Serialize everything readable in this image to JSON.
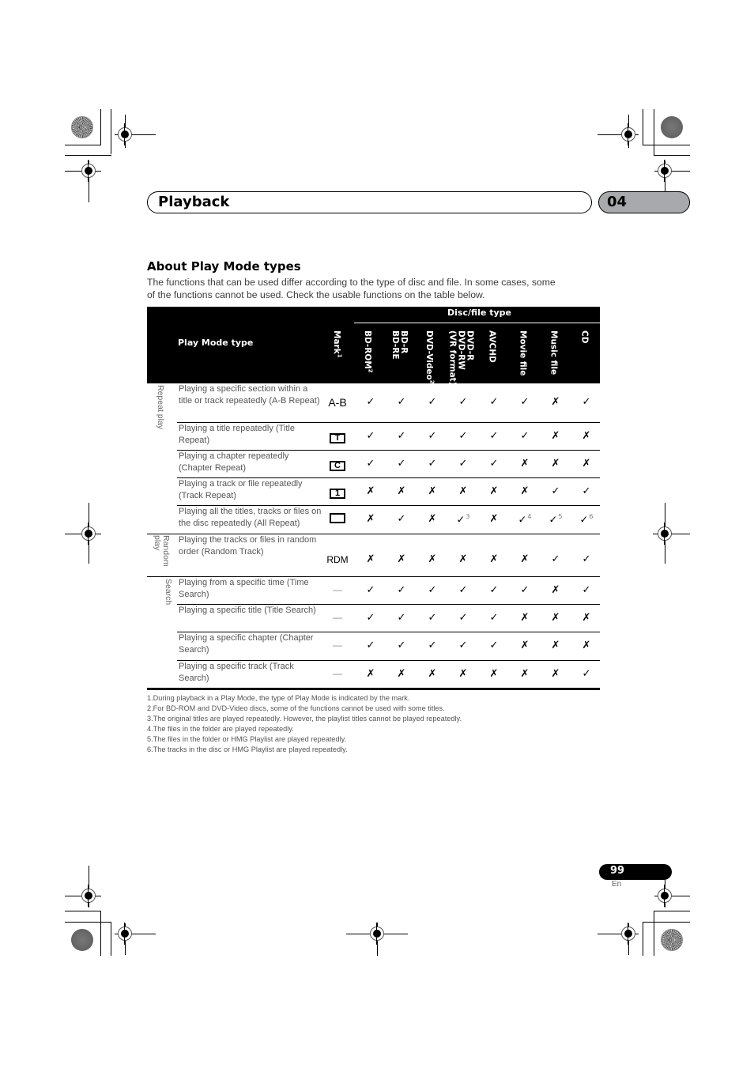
{
  "header": {
    "section_title": "Playback",
    "chapter_number": "04"
  },
  "section": {
    "heading": "About Play Mode types",
    "intro_line1": "The functions that can be used differ according to the type of disc and file. In some cases, some",
    "intro_line2": "of the functions cannot be used. Check the usable functions on the table below."
  },
  "table": {
    "disc_file_type_label": "Disc/file type",
    "play_mode_type_label": "Play Mode type",
    "mark_label": "Mark",
    "mark_note": "1",
    "columns": [
      {
        "label": "BD-ROM",
        "note": "2"
      },
      {
        "label": "BD-R\nBD-RE",
        "note": ""
      },
      {
        "label": "DVD-Video",
        "note": "2"
      },
      {
        "label": "DVD-R\nDVD-RW\n(VR format)",
        "note": ""
      },
      {
        "label": "AVCHD",
        "note": ""
      },
      {
        "label": "Movie file",
        "note": ""
      },
      {
        "label": "Music file",
        "note": ""
      },
      {
        "label": "CD",
        "note": ""
      }
    ],
    "groups": [
      {
        "label": "Repeat play"
      },
      {
        "label": "Random\nplay"
      },
      {
        "label": "Search"
      }
    ],
    "rows": [
      {
        "desc": "Playing a specific section within a title or track repeatedly (A-B Repeat)",
        "mark": "A-B",
        "mark_icon": "ab-repeat-icon",
        "values": [
          "✓",
          "✓",
          "✓",
          "✓",
          "✓",
          "✓",
          "✗",
          "✓"
        ],
        "notes": [
          "",
          "",
          "",
          "",
          "",
          "",
          "",
          ""
        ]
      },
      {
        "desc": "Playing a title repeatedly (Title Repeat)",
        "mark": "T",
        "mark_icon": "title-repeat-icon",
        "values": [
          "✓",
          "✓",
          "✓",
          "✓",
          "✓",
          "✓",
          "✗",
          "✗"
        ],
        "notes": [
          "",
          "",
          "",
          "",
          "",
          "",
          "",
          ""
        ]
      },
      {
        "desc": "Playing a chapter repeatedly (Chapter Repeat)",
        "mark": "C",
        "mark_icon": "chapter-repeat-icon",
        "values": [
          "✓",
          "✓",
          "✓",
          "✓",
          "✓",
          "✗",
          "✗",
          "✗"
        ],
        "notes": [
          "",
          "",
          "",
          "",
          "",
          "",
          "",
          ""
        ]
      },
      {
        "desc": "Playing a track or file repeatedly (Track Repeat)",
        "mark": "1",
        "mark_icon": "track-repeat-icon",
        "values": [
          "✗",
          "✗",
          "✗",
          "✗",
          "✗",
          "✗",
          "✓",
          "✓"
        ],
        "notes": [
          "",
          "",
          "",
          "",
          "",
          "",
          "",
          ""
        ]
      },
      {
        "desc": "Playing all the titles, tracks or files on the disc repeatedly (All Repeat)",
        "mark": "",
        "mark_icon": "all-repeat-icon",
        "values": [
          "✗",
          "✓",
          "✗",
          "✓",
          "✗",
          "✓",
          "✓",
          "✓"
        ],
        "notes": [
          "",
          "",
          "",
          "3",
          "",
          "4",
          "5",
          "6"
        ]
      },
      {
        "desc": "Playing the tracks or files in random order (Random Track)",
        "mark": "RDM",
        "mark_icon": "random-icon",
        "values": [
          "✗",
          "✗",
          "✗",
          "✗",
          "✗",
          "✗",
          "✓",
          "✓"
        ],
        "notes": [
          "",
          "",
          "",
          "",
          "",
          "",
          "",
          ""
        ]
      },
      {
        "desc": "Playing from a specific time (Time Search)",
        "mark": "—",
        "mark_icon": "",
        "values": [
          "✓",
          "✓",
          "✓",
          "✓",
          "✓",
          "✓",
          "✗",
          "✓"
        ],
        "notes": [
          "",
          "",
          "",
          "",
          "",
          "",
          "",
          ""
        ]
      },
      {
        "desc": "Playing a specific title (Title Search)",
        "mark": "—",
        "mark_icon": "",
        "values": [
          "✓",
          "✓",
          "✓",
          "✓",
          "✓",
          "✗",
          "✗",
          "✗"
        ],
        "notes": [
          "",
          "",
          "",
          "",
          "",
          "",
          "",
          ""
        ]
      },
      {
        "desc": "Playing a specific chapter (Chapter Search)",
        "mark": "—",
        "mark_icon": "",
        "values": [
          "✓",
          "✓",
          "✓",
          "✓",
          "✓",
          "✗",
          "✗",
          "✗"
        ],
        "notes": [
          "",
          "",
          "",
          "",
          "",
          "",
          "",
          ""
        ]
      },
      {
        "desc": "Playing a specific track (Track Search)",
        "mark": "—",
        "mark_icon": "",
        "values": [
          "✗",
          "✗",
          "✗",
          "✗",
          "✗",
          "✗",
          "✗",
          "✓"
        ],
        "notes": [
          "",
          "",
          "",
          "",
          "",
          "",
          "",
          ""
        ]
      }
    ]
  },
  "footnotes": [
    "1.During playback in a Play Mode, the type of Play Mode is indicated by the mark.",
    "2.For BD-ROM and DVD-Video discs, some of the functions cannot be used with some titles.",
    "3.The original titles are played repeatedly. However, the playlist titles cannot be played repeatedly.",
    "4.The files in the folder are played repeatedly.",
    "5.The files in the folder or HMG Playlist are played repeatedly.",
    "6.The tracks in the disc or HMG Playlist are played repeatedly."
  ],
  "footer": {
    "page_number": "99",
    "language": "En"
  }
}
